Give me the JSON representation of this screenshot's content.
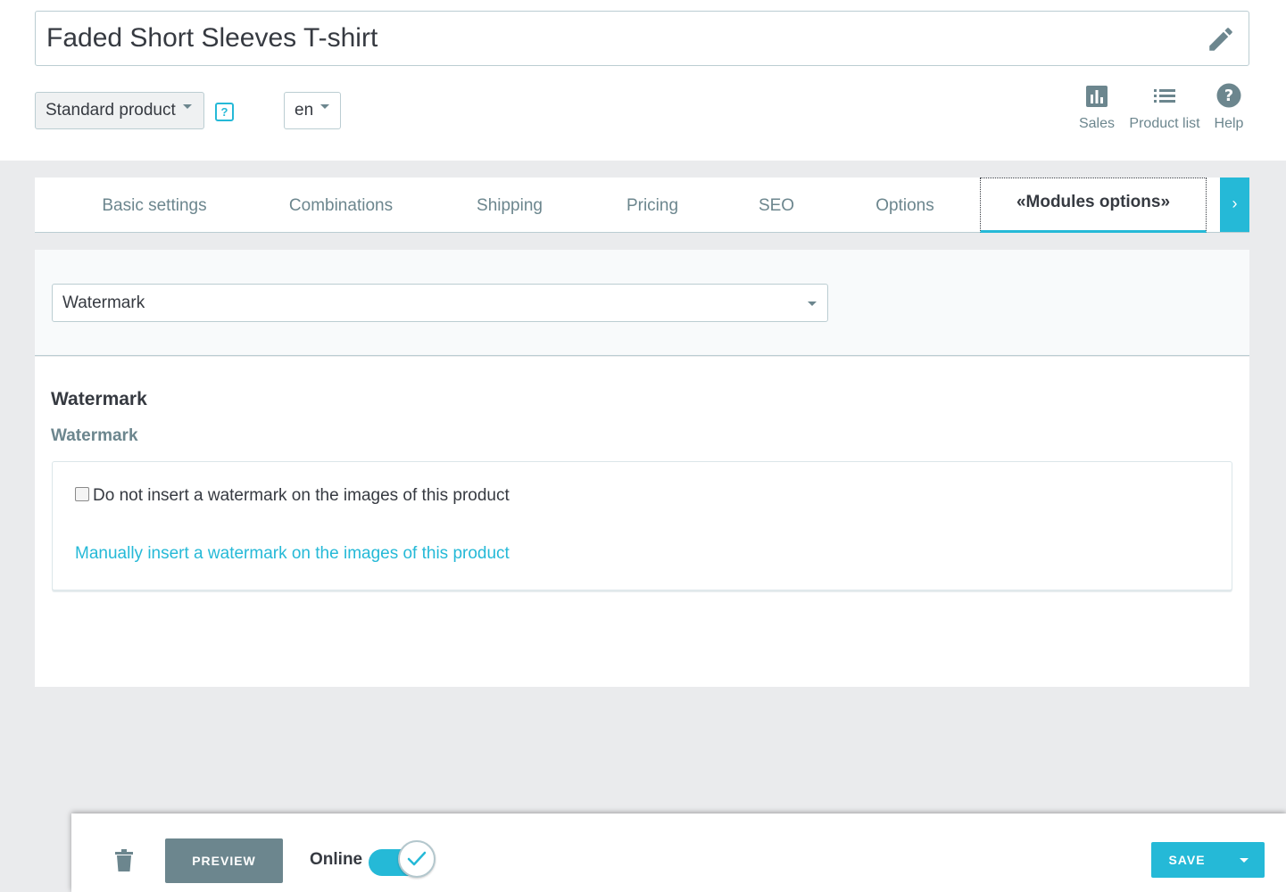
{
  "header": {
    "product_title": "Faded Short Sleeves T-shirt",
    "product_type": "Standard product",
    "help_badge": "?",
    "language": "en",
    "quick_links": [
      {
        "label": "Sales",
        "icon": "bar-chart-icon"
      },
      {
        "label": "Product list",
        "icon": "list-icon"
      },
      {
        "label": "Help",
        "icon": "help-circle-icon"
      }
    ]
  },
  "tabs": [
    {
      "label": "Basic settings"
    },
    {
      "label": "Combinations"
    },
    {
      "label": "Shipping"
    },
    {
      "label": "Pricing"
    },
    {
      "label": "SEO"
    },
    {
      "label": "Options"
    },
    {
      "label": "«Modules options»",
      "active": true
    }
  ],
  "tab_next": "›",
  "modules": {
    "selected": "Watermark"
  },
  "content": {
    "heading": "Watermark",
    "subheading": "Watermark",
    "checkbox_label": "Do not insert a watermark on the images of this product",
    "checkbox_checked": false,
    "manual_link": "Manually insert a watermark on the images of this product"
  },
  "footer": {
    "preview_label": "PREVIEW",
    "online_label": "Online",
    "online_enabled": true,
    "save_label": "SAVE"
  },
  "colors": {
    "accent": "#25b9d7",
    "muted": "#6c868e",
    "text": "#363a41"
  }
}
